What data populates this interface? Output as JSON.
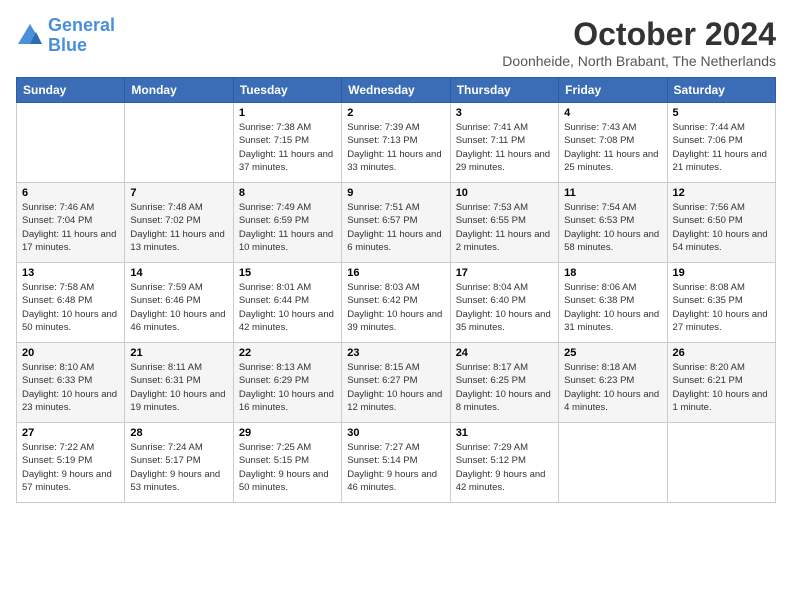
{
  "header": {
    "logo_line1": "General",
    "logo_line2": "Blue",
    "title": "October 2024",
    "location": "Doonheide, North Brabant, The Netherlands"
  },
  "days_of_week": [
    "Sunday",
    "Monday",
    "Tuesday",
    "Wednesday",
    "Thursday",
    "Friday",
    "Saturday"
  ],
  "weeks": [
    [
      {
        "day": "",
        "info": ""
      },
      {
        "day": "",
        "info": ""
      },
      {
        "day": "1",
        "info": "Sunrise: 7:38 AM\nSunset: 7:15 PM\nDaylight: 11 hours and 37 minutes."
      },
      {
        "day": "2",
        "info": "Sunrise: 7:39 AM\nSunset: 7:13 PM\nDaylight: 11 hours and 33 minutes."
      },
      {
        "day": "3",
        "info": "Sunrise: 7:41 AM\nSunset: 7:11 PM\nDaylight: 11 hours and 29 minutes."
      },
      {
        "day": "4",
        "info": "Sunrise: 7:43 AM\nSunset: 7:08 PM\nDaylight: 11 hours and 25 minutes."
      },
      {
        "day": "5",
        "info": "Sunrise: 7:44 AM\nSunset: 7:06 PM\nDaylight: 11 hours and 21 minutes."
      }
    ],
    [
      {
        "day": "6",
        "info": "Sunrise: 7:46 AM\nSunset: 7:04 PM\nDaylight: 11 hours and 17 minutes."
      },
      {
        "day": "7",
        "info": "Sunrise: 7:48 AM\nSunset: 7:02 PM\nDaylight: 11 hours and 13 minutes."
      },
      {
        "day": "8",
        "info": "Sunrise: 7:49 AM\nSunset: 6:59 PM\nDaylight: 11 hours and 10 minutes."
      },
      {
        "day": "9",
        "info": "Sunrise: 7:51 AM\nSunset: 6:57 PM\nDaylight: 11 hours and 6 minutes."
      },
      {
        "day": "10",
        "info": "Sunrise: 7:53 AM\nSunset: 6:55 PM\nDaylight: 11 hours and 2 minutes."
      },
      {
        "day": "11",
        "info": "Sunrise: 7:54 AM\nSunset: 6:53 PM\nDaylight: 10 hours and 58 minutes."
      },
      {
        "day": "12",
        "info": "Sunrise: 7:56 AM\nSunset: 6:50 PM\nDaylight: 10 hours and 54 minutes."
      }
    ],
    [
      {
        "day": "13",
        "info": "Sunrise: 7:58 AM\nSunset: 6:48 PM\nDaylight: 10 hours and 50 minutes."
      },
      {
        "day": "14",
        "info": "Sunrise: 7:59 AM\nSunset: 6:46 PM\nDaylight: 10 hours and 46 minutes."
      },
      {
        "day": "15",
        "info": "Sunrise: 8:01 AM\nSunset: 6:44 PM\nDaylight: 10 hours and 42 minutes."
      },
      {
        "day": "16",
        "info": "Sunrise: 8:03 AM\nSunset: 6:42 PM\nDaylight: 10 hours and 39 minutes."
      },
      {
        "day": "17",
        "info": "Sunrise: 8:04 AM\nSunset: 6:40 PM\nDaylight: 10 hours and 35 minutes."
      },
      {
        "day": "18",
        "info": "Sunrise: 8:06 AM\nSunset: 6:38 PM\nDaylight: 10 hours and 31 minutes."
      },
      {
        "day": "19",
        "info": "Sunrise: 8:08 AM\nSunset: 6:35 PM\nDaylight: 10 hours and 27 minutes."
      }
    ],
    [
      {
        "day": "20",
        "info": "Sunrise: 8:10 AM\nSunset: 6:33 PM\nDaylight: 10 hours and 23 minutes."
      },
      {
        "day": "21",
        "info": "Sunrise: 8:11 AM\nSunset: 6:31 PM\nDaylight: 10 hours and 19 minutes."
      },
      {
        "day": "22",
        "info": "Sunrise: 8:13 AM\nSunset: 6:29 PM\nDaylight: 10 hours and 16 minutes."
      },
      {
        "day": "23",
        "info": "Sunrise: 8:15 AM\nSunset: 6:27 PM\nDaylight: 10 hours and 12 minutes."
      },
      {
        "day": "24",
        "info": "Sunrise: 8:17 AM\nSunset: 6:25 PM\nDaylight: 10 hours and 8 minutes."
      },
      {
        "day": "25",
        "info": "Sunrise: 8:18 AM\nSunset: 6:23 PM\nDaylight: 10 hours and 4 minutes."
      },
      {
        "day": "26",
        "info": "Sunrise: 8:20 AM\nSunset: 6:21 PM\nDaylight: 10 hours and 1 minute."
      }
    ],
    [
      {
        "day": "27",
        "info": "Sunrise: 7:22 AM\nSunset: 5:19 PM\nDaylight: 9 hours and 57 minutes."
      },
      {
        "day": "28",
        "info": "Sunrise: 7:24 AM\nSunset: 5:17 PM\nDaylight: 9 hours and 53 minutes."
      },
      {
        "day": "29",
        "info": "Sunrise: 7:25 AM\nSunset: 5:15 PM\nDaylight: 9 hours and 50 minutes."
      },
      {
        "day": "30",
        "info": "Sunrise: 7:27 AM\nSunset: 5:14 PM\nDaylight: 9 hours and 46 minutes."
      },
      {
        "day": "31",
        "info": "Sunrise: 7:29 AM\nSunset: 5:12 PM\nDaylight: 9 hours and 42 minutes."
      },
      {
        "day": "",
        "info": ""
      },
      {
        "day": "",
        "info": ""
      }
    ]
  ]
}
